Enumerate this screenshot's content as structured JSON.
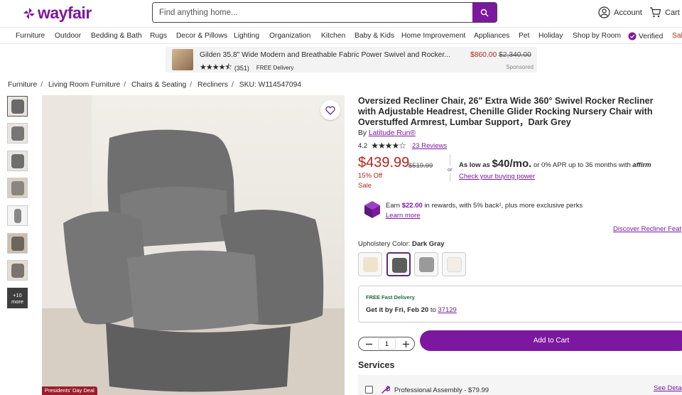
{
  "header": {
    "logo_text": "wayfair",
    "search_placeholder": "Find anything home...",
    "account_label": "Account",
    "cart_label": "Cart"
  },
  "nav": {
    "items": [
      "Furniture",
      "Outdoor",
      "Bedding & Bath",
      "Rugs",
      "Decor & Pillows",
      "Lighting",
      "Organization",
      "Kitchen",
      "Baby & Kids",
      "Home Improvement",
      "Appliances",
      "Pet",
      "Holiday",
      "Shop by Room",
      "Verified",
      "Sal"
    ]
  },
  "sponsored": {
    "title": "Gilden 35.8\" Wide Modern and Breathable Fabric Power Swivel and Rocker...",
    "stars": "★★★★⯪",
    "rating_count": "(351)",
    "delivery": "FREE Delivery",
    "price": "$860.00",
    "was_price": "$2,340.00",
    "sponsored_label": "Sponsored"
  },
  "breadcrumb": {
    "items": [
      "Furniture",
      "Living Room Furniture",
      "Chairs & Seating",
      "Recliners"
    ],
    "sku": "SKU: W114547094"
  },
  "gallery": {
    "more_label": "+10 more",
    "deal_badge": "Presidents' Day Deal"
  },
  "product": {
    "title": "Oversized Recliner Chair, 26\" Extra Wide 360° Swivel Rocker Recliner with Adjustable Headrest, Chenille Glider Rocking Nursery Chair with Overstuffed Armrest, Lumbar Support，Dark Grey",
    "brand_prefix": "By",
    "brand": "Latitude Run®",
    "rating": "4.2",
    "stars": "★★★★☆",
    "reviews": "23 Reviews",
    "price": "$439.99",
    "was_price": "$519.99",
    "discount": "15% Off",
    "sale_label": "Sale",
    "or": "or",
    "affirm_prefix": "As low as",
    "affirm_amount": "$40/mo.",
    "affirm_suffix": "or 0% APR up to 36 months with",
    "affirm_logo": "affirm",
    "buying_power": "Check your buying power",
    "rewards_prefix": "Earn",
    "rewards_amount": "$22.00",
    "rewards_suffix": "in rewards, with 5% back¹, plus more exclusive perks",
    "learn_more": "Learn more",
    "discover_link": "Discover Recliner Feat",
    "color_label": "Upholstery Color:",
    "color_value": "Dark Gray",
    "swatch_colors": [
      "#efe3cc",
      "#5c5c5c",
      "#9a9a9a",
      "#f2eee6"
    ],
    "delivery_tag": "FREE Fast Delivery",
    "delivery_prefix": "Get it by",
    "delivery_date": "Fri, Feb 20",
    "delivery_to": "to",
    "zip": "37129",
    "quantity": "1",
    "add_to_cart": "Add to Cart",
    "services_heading": "Services",
    "service_label": "Professional Assembly - $79.99",
    "see_details": "See Deta"
  },
  "colors": {
    "brand": "#7b189f",
    "sale": "#b3261e"
  }
}
